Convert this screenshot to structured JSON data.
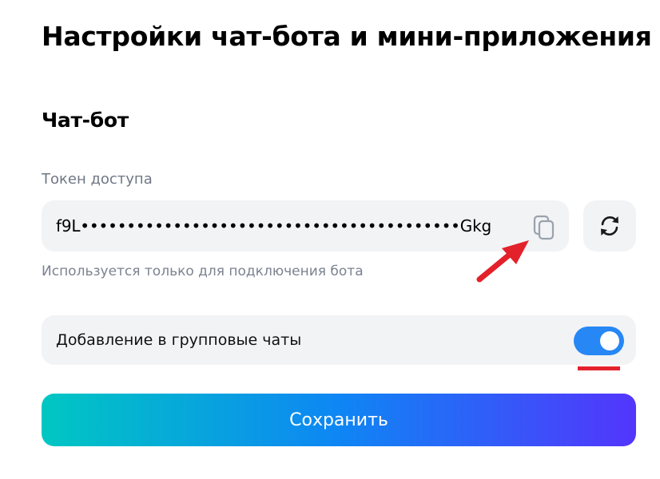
{
  "page": {
    "title": "Настройки чат-бота и мини-приложения"
  },
  "chatbot": {
    "section_title": "Чат-бот",
    "token_label": "Токен доступа",
    "token_value": "f9L•••••••••••••••••••••••••••••••••••••••••Gkg",
    "copy_icon": "copy-icon",
    "refresh_icon": "refresh-icon",
    "hint": "Используется только для подключения бота"
  },
  "group_chats": {
    "label": "Добавление в групповые чаты",
    "enabled": true
  },
  "actions": {
    "save_label": "Сохранить"
  },
  "annotations": {
    "arrow_color": "#e3212b",
    "underline_color": "#e3212b"
  },
  "colors": {
    "toggle_on": "#2787f5",
    "field_bg": "#f2f3f5",
    "button_gradient": [
      "#00c7c2",
      "#0e86f4",
      "#5335fc"
    ]
  }
}
